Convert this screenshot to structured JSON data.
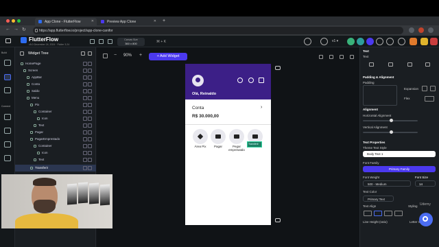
{
  "browser": {
    "tabs": [
      {
        "title": "App Clone - FlutterFlow"
      },
      {
        "title": "Preview App Clone"
      }
    ],
    "url": "https://app.flutterflow.io/project/app-clone-canifor"
  },
  "app": {
    "name": "FlutterFlow",
    "version": "v5.0 December 24, 2024 · Flutter 3.24",
    "canvas_size_label": "Canvas Size",
    "canvas_size": "360 x 800",
    "shortcut": "⌘ + K"
  },
  "rail": {
    "build_label": "Build",
    "connect_label": "Connect"
  },
  "widget_tree": {
    "title": "Widget Tree",
    "items": [
      {
        "label": "HomePage"
      },
      {
        "label": "Screen"
      },
      {
        "label": "AppBar"
      },
      {
        "label": "Conta"
      },
      {
        "label": "Saldo"
      },
      {
        "label": "Menu"
      },
      {
        "label": "Pix"
      },
      {
        "label": "Container"
      },
      {
        "label": "Icon"
      },
      {
        "label": "Text"
      },
      {
        "label": "Pagar"
      },
      {
        "label": "PagarEmprestado"
      },
      {
        "label": "Container"
      },
      {
        "label": "Icon"
      },
      {
        "label": "Text"
      },
      {
        "label": "Transferir"
      }
    ]
  },
  "canvas": {
    "zoom": "90%",
    "add_widget": "+ Add Widget",
    "greeting": "Olá, Reinaldo",
    "account_label": "Conta",
    "balance": "R$ 30.000,00",
    "actions": [
      {
        "label": "Área Pix"
      },
      {
        "label": "Pagar"
      },
      {
        "label": "Pegar empresatdo"
      },
      {
        "label": ""
      }
    ],
    "selected_tag": "Transferir"
  },
  "properties": {
    "widget_type": "Text",
    "widget_name": "Text",
    "padding_alignment": "Padding & Alignment",
    "padding": "Padding",
    "expansion": "Expansion",
    "flex": "Flex",
    "alignment": "Alignment",
    "horizontal_alignment": "Horizontal Alignment",
    "vertical_alignment": "Vertical Alignment",
    "text_properties": "Text Properties",
    "theme_text_style": "Theme Text Style",
    "theme_text_style_value": "Body Text 1",
    "font_family": "Font Family",
    "font_family_value": "Primary Family",
    "font_weight": "Font Weight",
    "font_weight_value": "500 - Medium",
    "font_size": "Font Size",
    "font_size_value": "14",
    "text_color": "Text Color",
    "text_color_value": "Primary Text",
    "text_align": "Text Align",
    "styling": "Styling",
    "line_height": "Line Height (ratio)",
    "letter": "Letter S"
  },
  "overlay": {
    "watermark": "Udemy"
  },
  "colors": {
    "accent": "#4b39ef",
    "phone_header": "#3c1f87",
    "selection": "#2fd4a0"
  }
}
